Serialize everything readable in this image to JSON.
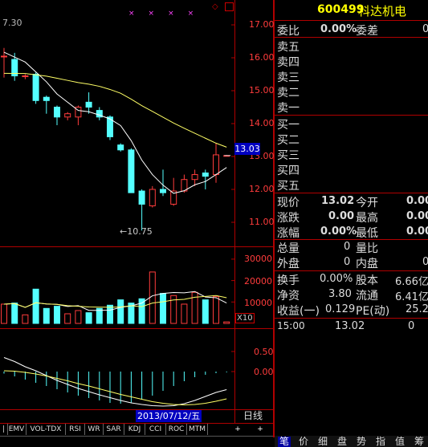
{
  "stock": {
    "code": "600499",
    "name": "科达机电"
  },
  "chart": {
    "top_left_value": "7.30",
    "price_axis": [
      "17.00",
      "16.00",
      "15.00",
      "14.00",
      "13.00",
      "12.00",
      "11.00"
    ],
    "current_price_tag": "13.03",
    "low_annotation": "←10.75",
    "volume_axis": [
      "30000",
      "20000",
      "10000"
    ],
    "volume_multiplier": "X10",
    "indicator_axis": [
      "0.50",
      "0.00"
    ],
    "date_label": "2013/07/12/五",
    "period_label": "日线",
    "candles": [
      {
        "o": 16.05,
        "c": 16.05,
        "h": 16.3,
        "l": 15.4,
        "dir": "up"
      },
      {
        "o": 15.95,
        "c": 15.45,
        "h": 16.15,
        "l": 15.3,
        "dir": "down"
      },
      {
        "o": 15.45,
        "c": 15.45,
        "h": 15.5,
        "l": 15.35,
        "dir": "up"
      },
      {
        "o": 15.5,
        "c": 14.7,
        "h": 15.55,
        "l": 14.6,
        "dir": "down"
      },
      {
        "o": 14.8,
        "c": 14.7,
        "h": 14.85,
        "l": 14.3,
        "dir": "down"
      },
      {
        "o": 14.5,
        "c": 14.2,
        "h": 14.55,
        "l": 13.95,
        "dir": "down"
      },
      {
        "o": 14.3,
        "c": 14.2,
        "h": 14.35,
        "l": 14.1,
        "dir": "up"
      },
      {
        "o": 14.5,
        "c": 14.2,
        "h": 14.55,
        "l": 13.95,
        "dir": "up"
      },
      {
        "o": 14.65,
        "c": 14.5,
        "h": 14.95,
        "l": 14.3,
        "dir": "down"
      },
      {
        "o": 14.4,
        "c": 14.2,
        "h": 14.5,
        "l": 14.1,
        "dir": "down"
      },
      {
        "o": 14.2,
        "c": 13.6,
        "h": 14.25,
        "l": 13.5,
        "dir": "down"
      },
      {
        "o": 13.35,
        "c": 13.2,
        "h": 13.4,
        "l": 13.15,
        "dir": "down"
      },
      {
        "o": 13.2,
        "c": 11.9,
        "h": 13.25,
        "l": 11.9,
        "dir": "down"
      },
      {
        "o": 11.95,
        "c": 11.55,
        "h": 12.0,
        "l": 10.75,
        "dir": "down"
      },
      {
        "o": 11.5,
        "c": 12.0,
        "h": 12.1,
        "l": 11.45,
        "dir": "up"
      },
      {
        "o": 11.9,
        "c": 12.0,
        "h": 12.6,
        "l": 11.8,
        "dir": "down"
      },
      {
        "o": 11.55,
        "c": 11.95,
        "h": 12.35,
        "l": 11.5,
        "dir": "up"
      },
      {
        "o": 11.95,
        "c": 12.3,
        "h": 12.45,
        "l": 11.9,
        "dir": "up"
      },
      {
        "o": 12.3,
        "c": 12.45,
        "h": 12.6,
        "l": 12.1,
        "dir": "up"
      },
      {
        "o": 12.4,
        "c": 12.5,
        "h": 12.6,
        "l": 12.0,
        "dir": "down"
      },
      {
        "o": 12.45,
        "c": 13.05,
        "h": 13.4,
        "l": 12.2,
        "dir": "up"
      },
      {
        "o": 13.02,
        "c": 13.03,
        "h": 13.05,
        "l": 13.0,
        "dir": "up"
      }
    ],
    "volumes": [
      9000,
      9500,
      4000,
      16000,
      7000,
      8000,
      4500,
      6000,
      5000,
      7000,
      8500,
      11000,
      9500,
      11500,
      24000,
      14000,
      13000,
      9000,
      14500,
      11000,
      12500,
      700
    ]
  },
  "indicator_tabs": [
    "EMV",
    "VOL-TDX",
    "RSI",
    "WR",
    "SAR",
    "KDJ",
    "CCI",
    "ROC",
    "MTM"
  ],
  "quote": {
    "weibi_label": "委比",
    "weibi_value": "0.00%",
    "weicha_label": "委差",
    "weicha_value": "0",
    "sell_labels": [
      "卖五",
      "卖四",
      "卖三",
      "卖二",
      "卖一"
    ],
    "buy_labels": [
      "买一",
      "买二",
      "买三",
      "买四",
      "买五"
    ],
    "rows": [
      {
        "l1": "现价",
        "v1": "13.02",
        "l2": "今开",
        "v2": "0.00"
      },
      {
        "l1": "涨跌",
        "v1": "0.00",
        "l2": "最高",
        "v2": "0.00"
      },
      {
        "l1": "涨幅",
        "v1": "0.00%",
        "l2": "最低",
        "v2": "0.00"
      },
      {
        "l1": "总量",
        "v1": "0",
        "l2": "量比",
        "v2": ""
      },
      {
        "l1": "外盘",
        "v1": "0",
        "l2": "内盘",
        "v2": "0"
      },
      {
        "l1": "换手",
        "v1": "0.00%",
        "l2": "股本",
        "v2": "6.66亿"
      },
      {
        "l1": "净资",
        "v1": "3.80",
        "l2": "流通",
        "v2": "6.41亿"
      },
      {
        "l1": "收益(一)",
        "v1": "0.129",
        "l2": "PE(动)",
        "v2": "25.2"
      }
    ],
    "tick": {
      "time": "15:00",
      "price": "13.02",
      "vol": "0"
    }
  },
  "bottom_tabs": [
    "笔",
    "价",
    "细",
    "盘",
    "势",
    "指",
    "值",
    "筹"
  ]
}
